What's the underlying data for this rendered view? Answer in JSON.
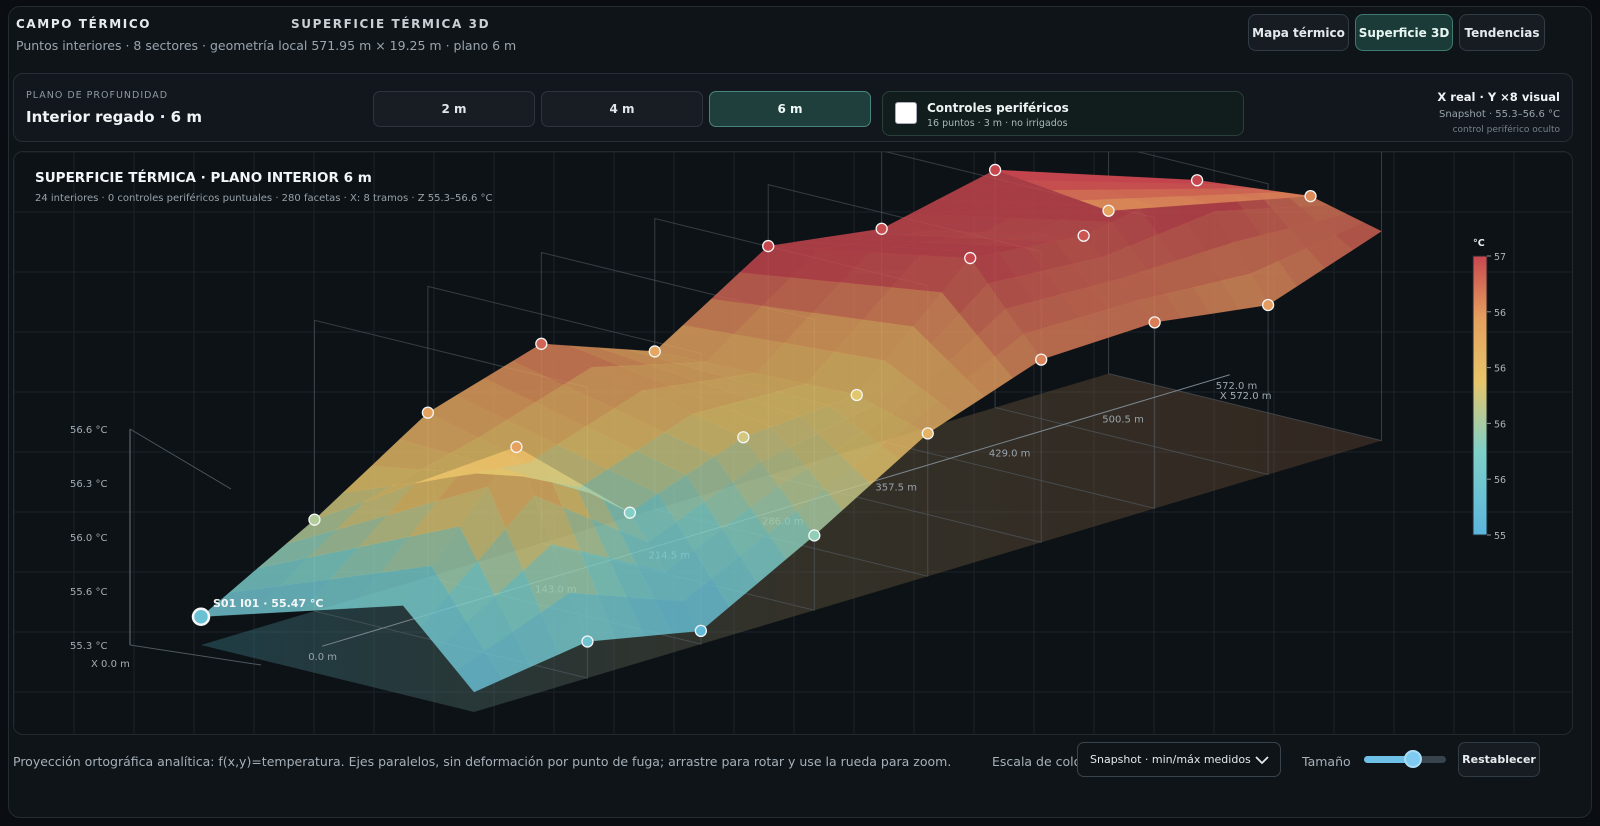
{
  "header": {
    "title": "CAMPO TÉRMICO",
    "mode": "SUPERFICIE TÉRMICA 3D",
    "subtitle": "Puntos interiores · 8 sectores · geometría local 571.95 m × 19.25 m · plano 6 m",
    "views": [
      {
        "label": "Mapa térmico",
        "active": false
      },
      {
        "label": "Superficie 3D",
        "active": true
      },
      {
        "label": "Tendencias",
        "active": false
      }
    ]
  },
  "controls": {
    "depth_label": "PLANO DE PROFUNDIDAD",
    "depth_value": "Interior regado · 6 m",
    "depth_options": [
      {
        "label": "2 m",
        "active": false
      },
      {
        "label": "4 m",
        "active": false
      },
      {
        "label": "6 m",
        "active": true
      }
    ],
    "peripheral": {
      "title": "Controles periféricos",
      "subtitle": "16 puntos · 3 m · no irrigados",
      "checked": false
    },
    "scale": {
      "title": "X real · Y ×8 visual",
      "snapshot": "Snapshot · 55.3–56.6 °C",
      "note": "control periférico oculto"
    }
  },
  "chart": {
    "title": "SUPERFICIE TÉRMICA · PLANO INTERIOR 6 m",
    "subtitle": "24 interiores · 0 controles periféricos puntuales · 280 facetas · X: 8 tramos · Z 55.3–56.6 °C",
    "z_ticks": [
      "56.6 °C",
      "56.3 °C",
      "56.0 °C",
      "55.6 °C",
      "55.3 °C"
    ],
    "x_ticks": [
      "0.0 m",
      "143.0 m",
      "214.5 m",
      "286.0 m",
      "357.5 m",
      "429.0 m",
      "500.5 m",
      "572.0 m"
    ],
    "x_start_label": "X 0.0 m",
    "x_end_label": "X 572.0 m",
    "highlight_label": "S01 I01 · 55.47 °C",
    "colorbar": {
      "unit": "°C",
      "ticks": [
        "57",
        "56",
        "56",
        "56",
        "56",
        "55"
      ]
    }
  },
  "chart_data": {
    "type": "surface",
    "title": "SUPERFICIE TÉRMICA · PLANO INTERIOR 6 m",
    "x_unit": "m",
    "z_unit": "°C",
    "zlim": [
      55.3,
      56.6
    ],
    "x": [
      0,
      71.5,
      143,
      214.5,
      286,
      357.5,
      429,
      500.5,
      572
    ],
    "rows": [
      {
        "name": "row-0",
        "z": [
          55.47,
          55.85,
          56.29,
          56.5,
          56.25,
          56.68,
          56.58,
          56.73,
          56.28
        ]
      },
      {
        "name": "row-1",
        "z": [
          55.55,
          56.3,
          55.7,
          55.95,
          56.0,
          56.62,
          56.55,
          56.68,
          56.38
        ]
      },
      {
        "name": "row-2",
        "z": [
          55.42,
          55.52,
          55.38,
          55.75,
          56.16,
          56.4,
          56.42,
          56.32,
          56.56
        ]
      }
    ],
    "points": [
      {
        "x": 0,
        "row": 0,
        "z": 55.47
      },
      {
        "x": 71.5,
        "row": 0,
        "z": 55.85
      },
      {
        "x": 143,
        "row": 0,
        "z": 56.29
      },
      {
        "x": 214.5,
        "row": 0,
        "z": 56.5
      },
      {
        "x": 286,
        "row": 0,
        "z": 56.25
      },
      {
        "x": 357.5,
        "row": 0,
        "z": 56.68
      },
      {
        "x": 429,
        "row": 0,
        "z": 56.58
      },
      {
        "x": 500.5,
        "row": 0,
        "z": 56.73
      },
      {
        "x": 572,
        "row": 0,
        "z": 56.28
      },
      {
        "x": 71.5,
        "row": 1,
        "z": 56.3
      },
      {
        "x": 143,
        "row": 1,
        "z": 55.7
      },
      {
        "x": 214.5,
        "row": 1,
        "z": 55.95
      },
      {
        "x": 286,
        "row": 1,
        "z": 56.0
      },
      {
        "x": 357.5,
        "row": 1,
        "z": 56.62
      },
      {
        "x": 429,
        "row": 1,
        "z": 56.55
      },
      {
        "x": 500.5,
        "row": 1,
        "z": 56.68
      },
      {
        "x": 572,
        "row": 1,
        "z": 56.38
      },
      {
        "x": 71.5,
        "row": 2,
        "z": 55.52
      },
      {
        "x": 143,
        "row": 2,
        "z": 55.38
      },
      {
        "x": 214.5,
        "row": 2,
        "z": 55.75
      },
      {
        "x": 286,
        "row": 2,
        "z": 56.16
      },
      {
        "x": 357.5,
        "row": 2,
        "z": 56.4
      },
      {
        "x": 429,
        "row": 2,
        "z": 56.42
      },
      {
        "x": 500.5,
        "row": 2,
        "z": 56.32
      }
    ],
    "colormap": [
      "#5bb5dd",
      "#7fd0c8",
      "#e7c56a",
      "#e59f5e",
      "#c8474f"
    ],
    "colorbar_range": [
      55,
      57
    ]
  },
  "footer": {
    "note": "Proyección ortográfica analítica: f(x,y)=temperatura. Ejes paralelos, sin deformación por punto de fuga; arrastre para rotar y use la rueda para zoom.",
    "color_scale_label": "Escala de color",
    "color_scale_value": "Snapshot · min/máx medidos",
    "size_label": "Tamaño",
    "size_value": 0.6,
    "reset_label": "Restablecer"
  }
}
